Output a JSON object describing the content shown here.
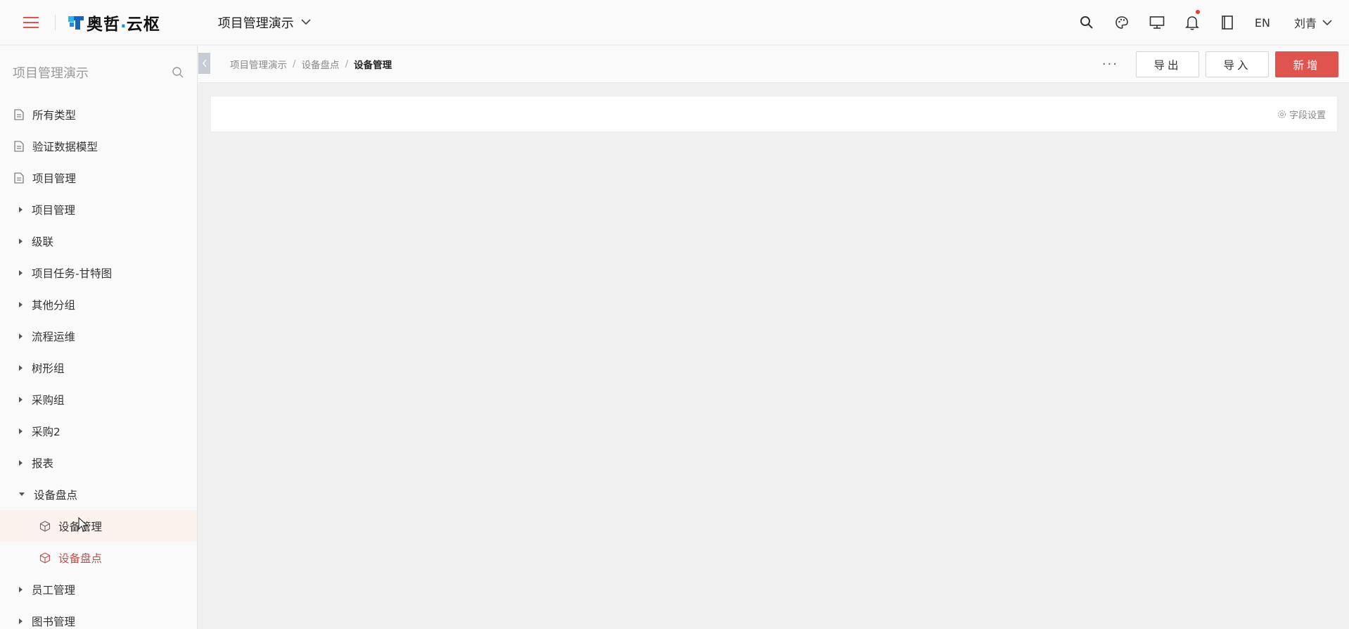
{
  "header": {
    "logo_text": "奥哲",
    "logo_dot": ".",
    "logo_text2": "云枢",
    "project_name": "项目管理演示",
    "lang": "EN",
    "user_name": "刘青",
    "notification_dot_color": "#e53935"
  },
  "sidebar": {
    "search_title": "项目管理演示",
    "items": [
      {
        "label": "所有类型",
        "kind": "top",
        "icon": "document-icon"
      },
      {
        "label": "验证数据模型",
        "kind": "top",
        "icon": "document-icon"
      },
      {
        "label": "项目管理",
        "kind": "top",
        "icon": "document-icon"
      },
      {
        "label": "项目管理",
        "kind": "group"
      },
      {
        "label": "级联",
        "kind": "group"
      },
      {
        "label": "项目任务-甘特图",
        "kind": "group"
      },
      {
        "label": "其他分组",
        "kind": "group"
      },
      {
        "label": "流程运维",
        "kind": "group"
      },
      {
        "label": "树形组",
        "kind": "group"
      },
      {
        "label": "采购组",
        "kind": "group"
      },
      {
        "label": "采购2",
        "kind": "group"
      },
      {
        "label": "报表",
        "kind": "group"
      },
      {
        "label": "设备盘点",
        "kind": "group",
        "expanded": true
      },
      {
        "label": "设备管理",
        "kind": "child",
        "icon": "cube-icon",
        "state": "hover"
      },
      {
        "label": "设备盘点",
        "kind": "child",
        "icon": "cube-icon",
        "state": "active"
      },
      {
        "label": "员工管理",
        "kind": "group"
      },
      {
        "label": "图书管理",
        "kind": "group"
      }
    ]
  },
  "breadcrumb": {
    "items": [
      "项目管理演示",
      "设备盘点"
    ],
    "current": "设备管理"
  },
  "toolbar": {
    "more_label": "···",
    "export_label": "导出",
    "import_label": "导入",
    "add_label": "新增",
    "primary_color": "#e0544f"
  },
  "panel": {
    "field_setting_label": "字段设置"
  }
}
